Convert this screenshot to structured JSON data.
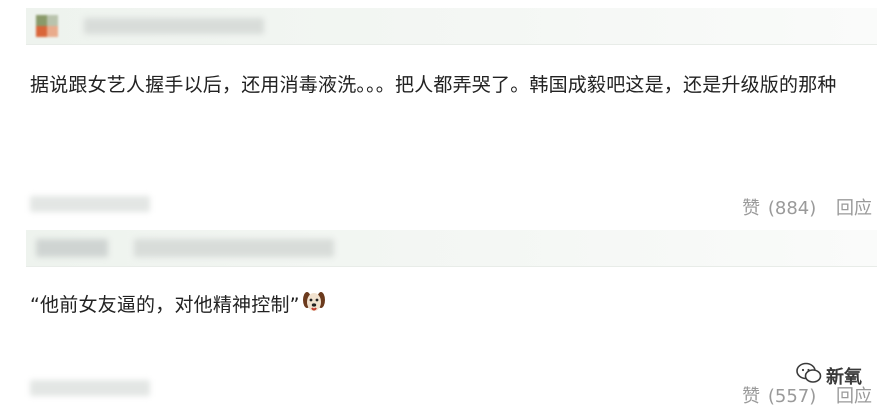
{
  "comments": [
    {
      "text": "据说跟女艺人握手以后，还用消毒液洗。。。把人都弄哭了。韩国成毅吧这是，还是升级版的那种",
      "like_label": "赞",
      "like_count": "(884)",
      "reply_label": "回应"
    },
    {
      "text": "“他前女友逼的，对他精神控制”",
      "emoji_icon": "dog-face-icon",
      "like_label": "赞",
      "like_count": "(557)",
      "reply_label": "回应"
    }
  ],
  "watermark": {
    "icon": "wechat-icon",
    "label": "新氧"
  }
}
